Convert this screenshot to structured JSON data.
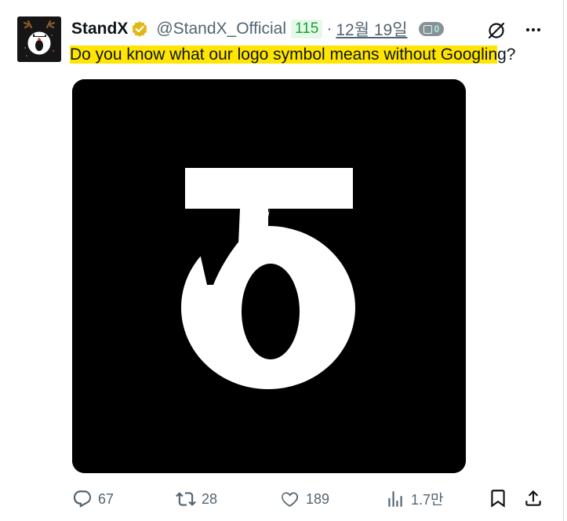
{
  "tweet": {
    "author_name": "StandX",
    "handle": "@StandX_Official",
    "score_badge": "115",
    "separator": "·",
    "date": "12월 19일",
    "x_badge": "0",
    "text_highlighted": "Do you know what our logo symbol means without Googlin",
    "text_rest": "g?",
    "logo_glyph": "ẟ"
  },
  "actions": {
    "replies": "67",
    "reposts": "28",
    "likes": "189",
    "views": "1.7만"
  },
  "icons": {
    "verified": "verified-badge-icon",
    "grok": "grok-icon",
    "more": "more-icon",
    "reply": "reply-icon",
    "repost": "repost-icon",
    "like": "like-icon",
    "views": "views-icon",
    "bookmark": "bookmark-icon",
    "share": "share-icon"
  },
  "colors": {
    "verified_gold": "#e2b719",
    "highlight": "#ffe500",
    "score_green": "#18a33a",
    "muted": "#536471"
  }
}
